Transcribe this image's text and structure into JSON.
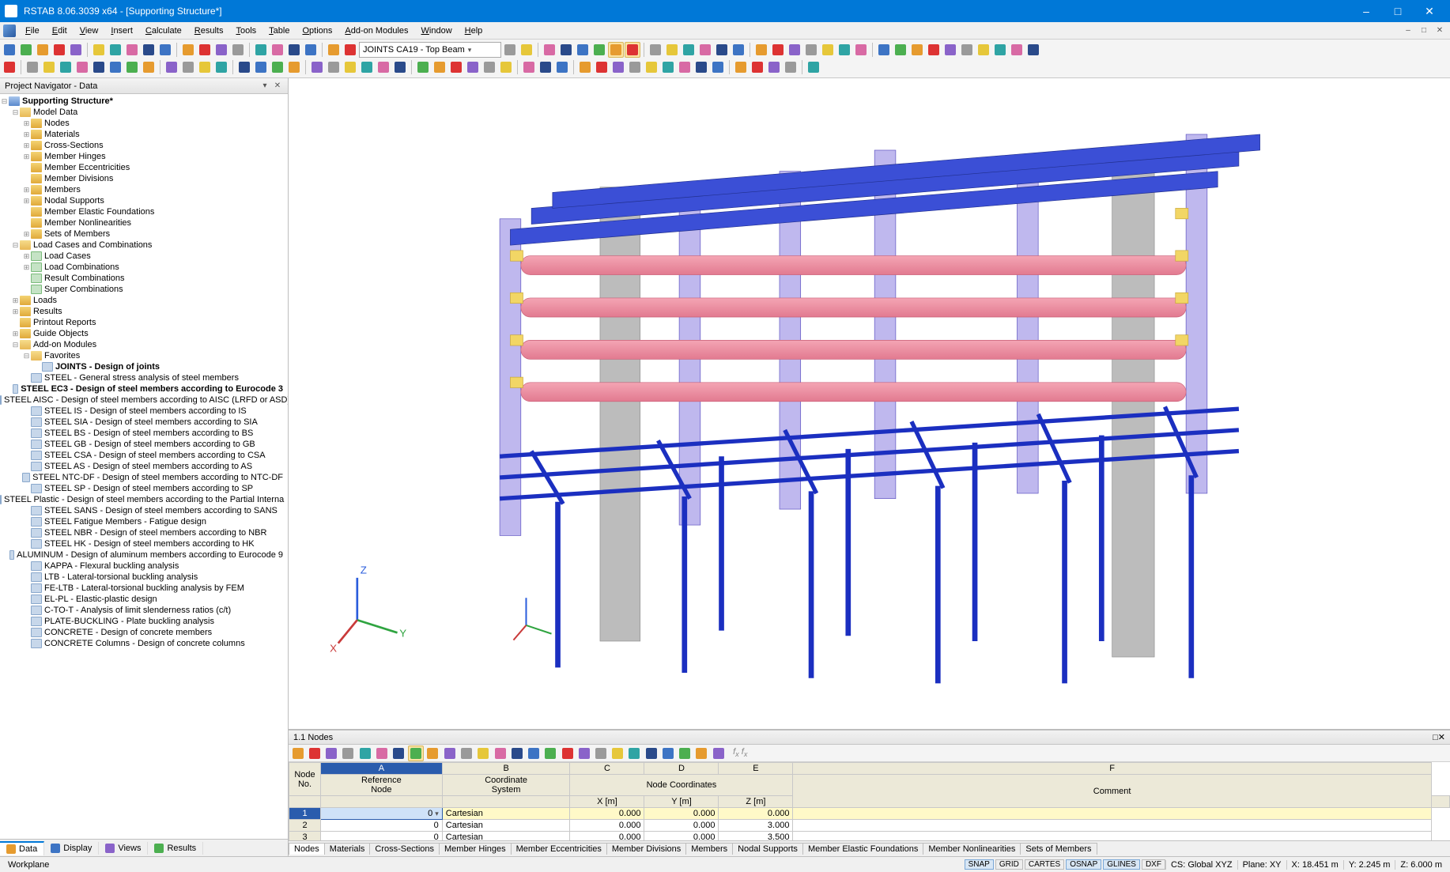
{
  "title": "RSTAB 8.06.3039 x64 - [Supporting Structure*]",
  "menu": [
    "File",
    "Edit",
    "View",
    "Insert",
    "Calculate",
    "Results",
    "Tools",
    "Table",
    "Options",
    "Add-on Modules",
    "Window",
    "Help"
  ],
  "toolbar_combo": "JOINTS CA19 - Top Beam",
  "navigator": {
    "title": "Project Navigator - Data",
    "root": "Supporting Structure*",
    "model_data": {
      "label": "Model Data",
      "items": [
        "Nodes",
        "Materials",
        "Cross-Sections",
        "Member Hinges",
        "Member Eccentricities",
        "Member Divisions",
        "Members",
        "Nodal Supports",
        "Member Elastic Foundations",
        "Member Nonlinearities",
        "Sets of Members"
      ]
    },
    "load_cases": {
      "label": "Load Cases and Combinations",
      "items": [
        "Load Cases",
        "Load Combinations",
        "Result Combinations",
        "Super Combinations"
      ]
    },
    "loads": "Loads",
    "results": "Results",
    "printout": "Printout Reports",
    "guide": "Guide Objects",
    "addon": {
      "label": "Add-on Modules",
      "favorites": "Favorites",
      "fav_item": "JOINTS - Design of joints",
      "modules": [
        "STEEL - General stress analysis of steel members",
        "STEEL EC3 - Design of steel members according to Eurocode 3",
        "STEEL AISC - Design of steel members according to AISC (LRFD or ASD)",
        "STEEL IS - Design of steel members according to IS",
        "STEEL SIA - Design of steel members according to SIA",
        "STEEL BS - Design of steel members according to BS",
        "STEEL GB - Design of steel members according to GB",
        "STEEL CSA - Design of steel members according to CSA",
        "STEEL AS - Design of steel members according to AS",
        "STEEL NTC-DF - Design of steel members according to NTC-DF",
        "STEEL SP - Design of steel members according to SP",
        "STEEL Plastic - Design of steel members according to the Partial Interna",
        "STEEL SANS - Design of steel members according to SANS",
        "STEEL Fatigue Members - Fatigue design",
        "STEEL NBR - Design of steel members according to NBR",
        "STEEL HK - Design of steel members according to HK",
        "ALUMINUM - Design of aluminum members according to Eurocode 9",
        "KAPPA - Flexural buckling analysis",
        "LTB - Lateral-torsional buckling analysis",
        "FE-LTB - Lateral-torsional buckling analysis by FEM",
        "EL-PL - Elastic-plastic design",
        "C-TO-T - Analysis of limit slenderness ratios (c/t)",
        "PLATE-BUCKLING - Plate buckling analysis",
        "CONCRETE - Design of concrete members",
        "CONCRETE Columns - Design of concrete columns"
      ]
    },
    "tabs": [
      "Data",
      "Display",
      "Views",
      "Results"
    ]
  },
  "table": {
    "title": "1.1 Nodes",
    "col_letters": [
      "A",
      "B",
      "C",
      "D",
      "E",
      "F"
    ],
    "group_headers": {
      "node_no": "Node\nNo.",
      "ref": "Reference\nNode",
      "coord": "Coordinate\nSystem",
      "node_coords": "Node Coordinates",
      "x": "X [m]",
      "y": "Y [m]",
      "z": "Z [m]",
      "comment": "Comment"
    },
    "rows": [
      {
        "no": "1",
        "ref": "0",
        "sys": "Cartesian",
        "x": "0.000",
        "y": "0.000",
        "z": "0.000",
        "comment": ""
      },
      {
        "no": "2",
        "ref": "0",
        "sys": "Cartesian",
        "x": "0.000",
        "y": "0.000",
        "z": "3.000",
        "comment": ""
      },
      {
        "no": "3",
        "ref": "0",
        "sys": "Cartesian",
        "x": "0.000",
        "y": "0.000",
        "z": "3.500",
        "comment": ""
      }
    ],
    "tabs": [
      "Nodes",
      "Materials",
      "Cross-Sections",
      "Member Hinges",
      "Member Eccentricities",
      "Member Divisions",
      "Members",
      "Nodal Supports",
      "Member Elastic Foundations",
      "Member Nonlinearities",
      "Sets of Members"
    ]
  },
  "status": {
    "left": "Workplane",
    "toggles": [
      "SNAP",
      "GRID",
      "CARTES",
      "OSNAP",
      "GLINES",
      "DXF"
    ],
    "cs": "CS: Global XYZ",
    "plane": "Plane: XY",
    "x": "X:  18.451 m",
    "y": "Y:  2.245 m",
    "z": "Z:  6.000 m"
  },
  "axes": {
    "x": "X",
    "y": "Y",
    "z": "Z"
  }
}
